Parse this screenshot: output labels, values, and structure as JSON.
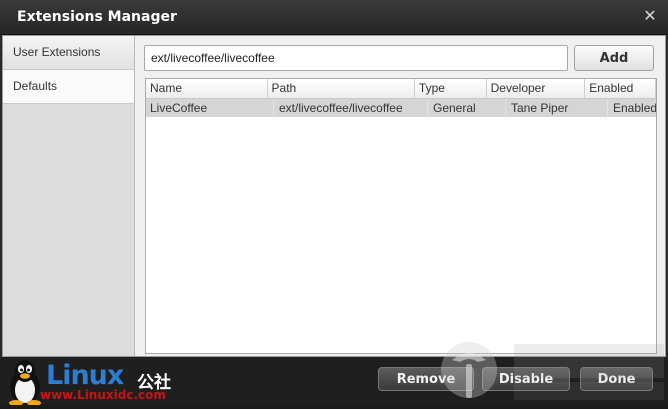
{
  "window": {
    "title": "Extensions Manager"
  },
  "sidebar": {
    "items": [
      {
        "label": "User Extensions"
      },
      {
        "label": "Defaults"
      }
    ]
  },
  "main": {
    "path_input": {
      "value": "ext/livecoffee/livecoffee"
    },
    "add_label": "Add"
  },
  "table": {
    "columns": [
      "Name",
      "Path",
      "Type",
      "Developer",
      "Enabled"
    ],
    "rows": [
      {
        "name": "LiveCoffee",
        "path": "ext/livecoffee/livecoffee",
        "type": "General",
        "developer": "Tane Piper",
        "enabled": "Enabled"
      }
    ]
  },
  "footer": {
    "remove_label": "Remove",
    "disable_label": "Disable",
    "done_label": "Done"
  },
  "logo": {
    "brand": "Linux",
    "cn": "公社",
    "url": "www.Linuxidc.com"
  },
  "colors": {
    "accent_blue": "#2a7fd4",
    "url_red": "#c41616",
    "selected_row": "#d5d5d5"
  }
}
